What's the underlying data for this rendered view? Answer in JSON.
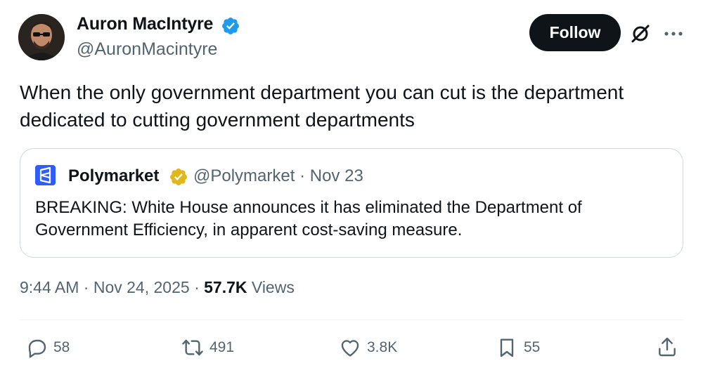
{
  "author": {
    "name": "Auron MacIntyre",
    "handle": "@AuronMacintyre"
  },
  "follow_label": "Follow",
  "tweet_text": "When the only government department you can cut is the department dedicated to cutting government departments",
  "quote": {
    "name": "Polymarket",
    "handle": "@Polymarket",
    "separator": "·",
    "date": "Nov 23",
    "text": "BREAKING: White House announces it has eliminated the Department of Government Efficiency, in apparent cost-saving measure."
  },
  "meta": {
    "time": "9:44 AM",
    "date": "Nov 24, 2025",
    "views_count": "57.7K",
    "views_label": "Views"
  },
  "actions": {
    "replies": "58",
    "reposts": "491",
    "likes": "3.8K",
    "bookmarks": "55"
  },
  "colors": {
    "accent_blue": "#1d9bf0",
    "gold_badge": "#e2b719",
    "polymarket_blue": "#2e5cff"
  },
  "icons": [
    "verified-badge-icon",
    "grok-icon",
    "more-icon",
    "reply-icon",
    "repost-icon",
    "like-icon",
    "bookmark-icon",
    "share-icon"
  ]
}
